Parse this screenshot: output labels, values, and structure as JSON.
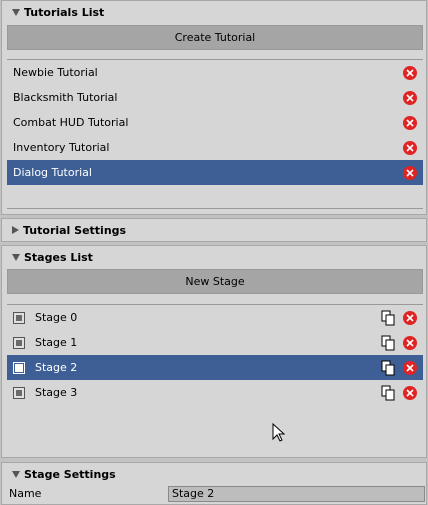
{
  "tutorials_list": {
    "title": "Tutorials List",
    "create_button": "Create Tutorial",
    "items": [
      {
        "label": "Newbie Tutorial",
        "selected": false
      },
      {
        "label": "Blacksmith Tutorial",
        "selected": false
      },
      {
        "label": "Combat HUD Tutorial",
        "selected": false
      },
      {
        "label": "Inventory Tutorial",
        "selected": false
      },
      {
        "label": "Dialog Tutorial",
        "selected": true
      }
    ]
  },
  "tutorial_settings": {
    "title": "Tutorial Settings",
    "expanded": false
  },
  "stages_list": {
    "title": "Stages List",
    "new_button": "New Stage",
    "items": [
      {
        "label": "Stage 0",
        "selected": false
      },
      {
        "label": "Stage 1",
        "selected": false
      },
      {
        "label": "Stage 2",
        "selected": true
      },
      {
        "label": "Stage 3",
        "selected": false
      }
    ]
  },
  "stage_settings": {
    "title": "Stage Settings",
    "name_label": "Name",
    "name_value": "Stage 2"
  },
  "colors": {
    "selection": "#3e5f96",
    "delete": "#e02424",
    "panel": "#d6d6d6"
  },
  "icons": {
    "delete": "delete-icon",
    "copy": "copy-icon",
    "collapse": "triangle-down-icon",
    "expand": "triangle-right-icon",
    "checkbox": "checkbox-icon"
  }
}
